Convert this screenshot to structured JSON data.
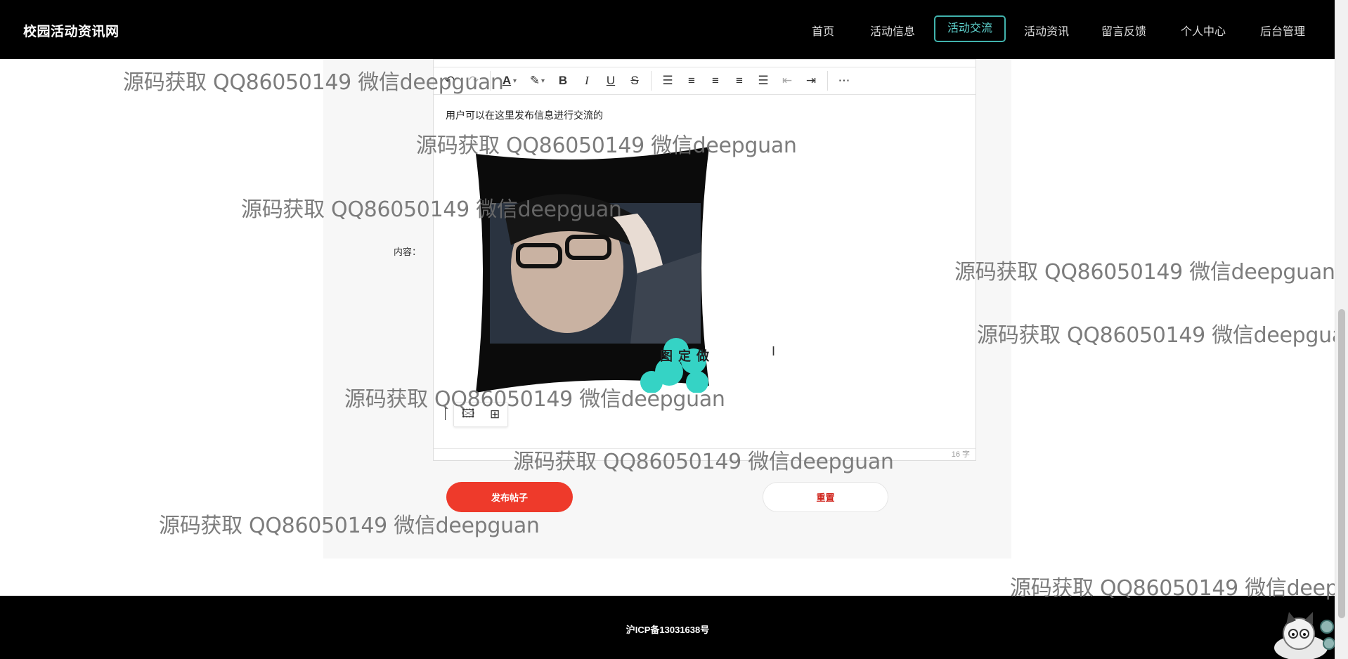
{
  "site": {
    "brand": "校园活动资讯网",
    "nav": [
      {
        "label": "首页"
      },
      {
        "label": "活动信息"
      },
      {
        "label": "活动交流",
        "active": true
      },
      {
        "label": "活动资讯"
      },
      {
        "label": "留言反馈"
      },
      {
        "label": "个人中心"
      },
      {
        "label": "后台管理"
      }
    ]
  },
  "form": {
    "content_label": "内容：",
    "editor": {
      "text": "用户可以在这里发布信息进行交流的",
      "word_count": "16 字",
      "image_caption": "图定做",
      "toolbar_icons": [
        "undo-icon",
        "redo-icon",
        "font-color-icon",
        "highlight-icon",
        "bold-icon",
        "italic-icon",
        "underline-icon",
        "strikethrough-icon",
        "list-icon",
        "align-left-icon",
        "align-center-icon",
        "align-right-icon",
        "justify-icon",
        "outdent-icon",
        "indent-icon",
        "more-icon"
      ]
    },
    "submit_label": "发布帖子",
    "reset_label": "重置"
  },
  "footer": {
    "icp": "沪ICP备13031638号"
  },
  "watermark": {
    "text": "源码获取 QQ86050149 微信deepguan",
    "text_truncated": "源码获取 QQ86050149 微信deepg"
  },
  "colors": {
    "nav_active": "#41b3ad",
    "submit": "#ee3a2b",
    "reset_text": "#d0241c"
  }
}
